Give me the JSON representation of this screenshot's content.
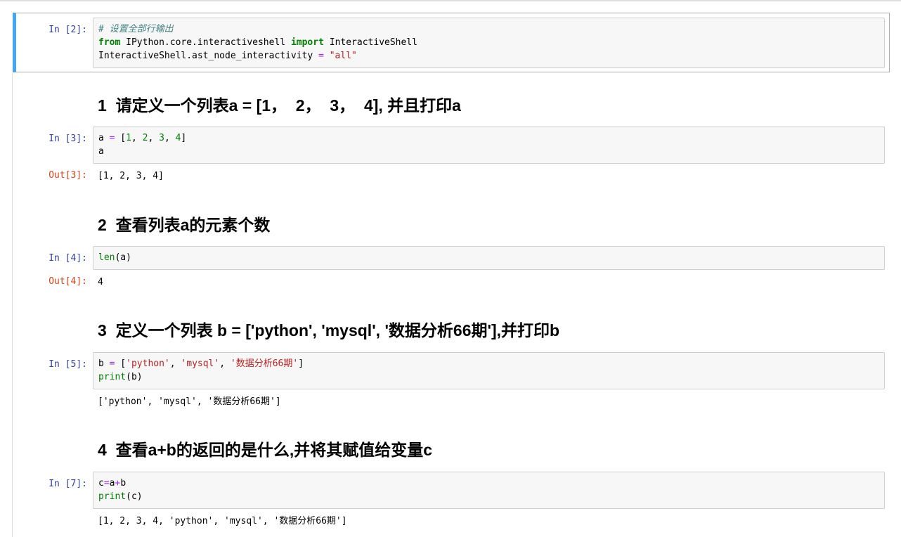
{
  "cells": {
    "c1": {
      "prompt": "In  [2]:",
      "line1": "# 设置全部行输出",
      "line2": {
        "kw_from": "from",
        "module": " IPython.core.interactiveshell ",
        "kw_import": "import",
        "name": " InteractiveShell"
      },
      "line3": {
        "lhs": "InteractiveShell.ast_node_interactivity ",
        "op": "=",
        "sp": " ",
        "str": "\"all\""
      }
    },
    "h1": "1  请定义一个列表a = [1，  2，  3，  4], 并且打印a",
    "c2": {
      "prompt": "In  [3]:",
      "line1": {
        "var": "a ",
        "op": "=",
        "open": " [",
        "n1": "1",
        "s1": ", ",
        "n2": "2",
        "s2": ", ",
        "n3": "3",
        "s3": ", ",
        "n4": "4",
        "close": "]"
      },
      "line2": "a",
      "out_prompt": "Out[3]:",
      "output": "[1, 2, 3, 4]"
    },
    "h2": "2  查看列表a的元素个数",
    "c3": {
      "prompt": "In  [4]:",
      "fn": "len",
      "args": "(a)",
      "out_prompt": "Out[4]:",
      "output": "4"
    },
    "h3": "3  定义一个列表 b = ['python', 'mysql', '数据分析66期'],并打印b",
    "c4": {
      "prompt": "In  [5]:",
      "line1": {
        "var": "b ",
        "op": "=",
        "open": " [",
        "s1": "'python'",
        "sep1": ", ",
        "s2": "'mysql'",
        "sep2": ", ",
        "s3": "'数据分析66期'",
        "close": "]"
      },
      "line2": {
        "fn": "print",
        "args": "(b)"
      },
      "output": "['python', 'mysql', '数据分析66期']"
    },
    "h4": "4  查看a+b的返回的是什么,并将其赋值给变量c",
    "c5": {
      "prompt": "In  [7]:",
      "line1": {
        "c": "c",
        "eq": "=",
        "a": "a",
        "plus": "+",
        "b": "b"
      },
      "line2": {
        "fn": "print",
        "args": "(c)"
      },
      "output": "[1, 2, 3, 4, 'python', 'mysql', '数据分析66期']"
    }
  }
}
